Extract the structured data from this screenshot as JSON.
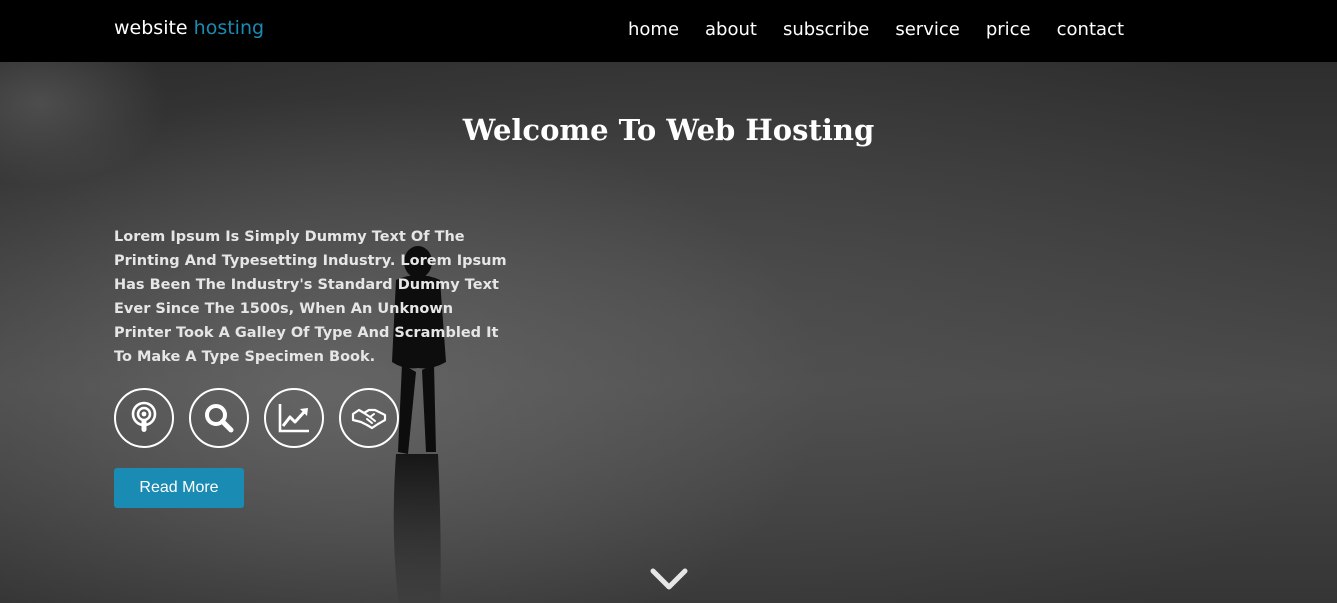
{
  "logo": {
    "part1": "website",
    "part2": "hosting"
  },
  "nav": {
    "items": [
      {
        "label": "home"
      },
      {
        "label": "about"
      },
      {
        "label": "subscribe"
      },
      {
        "label": "service"
      },
      {
        "label": "price"
      },
      {
        "label": "contact"
      }
    ]
  },
  "hero": {
    "title": "Welcome To Web Hosting",
    "body": "Lorem Ipsum Is Simply Dummy Text Of The Printing And Typesetting Industry. Lorem Ipsum Has Been The Industry's Standard Dummy Text Ever Since The 1500s, When An Unknown Printer Took A Galley Of Type And Scrambled It To Make A Type Specimen Book.",
    "icons": [
      "podcast-icon",
      "search-icon",
      "chart-line-icon",
      "handshake-icon"
    ],
    "button_label": "Read More",
    "scroll_icon": "chevron-down-icon"
  },
  "colors": {
    "accent": "#1a8bb3",
    "navbar_bg": "#000000",
    "text": "#ffffff"
  }
}
